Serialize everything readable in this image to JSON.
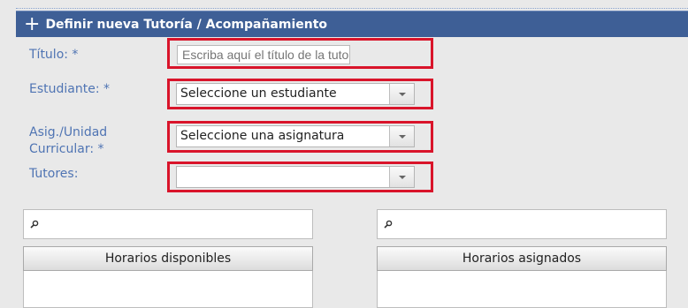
{
  "header": {
    "title": "Definir nueva Tutoría / Acompañamiento"
  },
  "form": {
    "title_label": "Título: *",
    "title_placeholder": "Escriba aquí el título de la tutoría",
    "student_label": "Estudiante: *",
    "student_value": "Seleccione un estudiante",
    "subject_label_line1": "Asig./Unidad",
    "subject_label_line2": "Curricular: *",
    "subject_value": "Seleccione una asignatura",
    "tutors_label": "Tutores:",
    "tutors_value": ""
  },
  "schedules": {
    "available_header": "Horarios disponibles",
    "assigned_header": "Horarios asignados"
  },
  "colors": {
    "header_bg": "#3e5f96",
    "label": "#4f74b3",
    "highlight": "#d9142a"
  }
}
